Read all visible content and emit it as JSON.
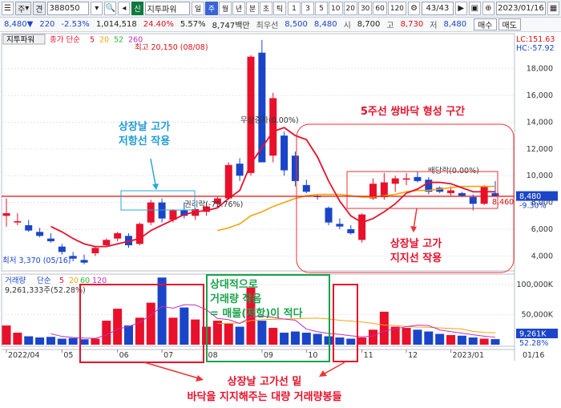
{
  "toolbar": {
    "market_selector": "주",
    "type_selector": "견",
    "code": "388050",
    "badge": "신",
    "name": "지투파워",
    "periods": [
      "일",
      "주",
      "월",
      "년",
      "분",
      "초",
      "틱"
    ],
    "selected_period": "주",
    "intervals": [
      "1",
      "3",
      "5",
      "10",
      "20",
      "30",
      "60",
      "120"
    ],
    "page_counter": "43",
    "page_total": "/43",
    "date": "2023/01/16"
  },
  "quote": {
    "price": "8,480▼",
    "change": "220",
    "change_pct": "-2.53%",
    "volume": "1,014,518",
    "turnover_pct": "24.40%",
    "vol_ratio": "5.57%",
    "trade_value": "8,747백만",
    "best_ask_label": "최우선",
    "best_ask": "8,500",
    "best_bid": "8,480",
    "open_label": "시",
    "open": "8,700",
    "high_label": "고",
    "high": "8,730",
    "low_label": "저",
    "low": "8,480",
    "sell_button": "매수",
    "buy_button": "매도"
  },
  "price_panel": {
    "legend_name": "지투파워",
    "legend_ma_label": "종가 단순",
    "ma_periods": [
      "5",
      "20",
      "52",
      "260"
    ],
    "ma_colors": [
      "#e8102b",
      "#f2a40d",
      "#2dbb2d",
      "#c02dc0"
    ],
    "lc": "LC:151.63",
    "hc": "HC:-57.92",
    "y_ticks": [
      "18,000",
      "16,000",
      "14,000",
      "12,000",
      "10,000",
      "8,000",
      "6,000",
      "4,000"
    ],
    "current_price": "8,480",
    "current_pct": "-9.30%",
    "ref_price": "8,460",
    "high_note": "최고 20,150 (08/08)",
    "low_note": "최저 3,370 (05/16)",
    "event_bonus": "무상증자(0.00%)",
    "event_lock": "권리락(-79.76%)",
    "event_dividend": "배당락(0.00%)"
  },
  "volume_panel": {
    "legend_name": "거래량",
    "legend_ma_label": "단순",
    "ma_periods": [
      "5",
      "20",
      "60",
      "120"
    ],
    "ma_colors": [
      "#e8102b",
      "#f2a40d",
      "#2dbb2d",
      "#c02dc0"
    ],
    "value": "9,261,333주(52.28%)",
    "y_ticks": [
      "100,000K",
      "50,000K"
    ],
    "current_value": "9,261K",
    "current_pct": "52.28%"
  },
  "x_axis": {
    "labels": [
      "2022/04",
      "05",
      "06",
      "07",
      "08",
      "09",
      "10",
      "11",
      "12",
      "2023/01"
    ],
    "right_label": "01/16"
  },
  "annotations": {
    "top_resistance": [
      "상장날 고가",
      "저항선 작용"
    ],
    "double_bottom": "5주선 쌍바닥 형성 구간",
    "support": [
      "상장날 고가",
      "지지선 작용"
    ],
    "volume_note": [
      "상대적으로",
      "거래량 작음",
      "= 매물(저항)이 적다"
    ],
    "bottom_note": [
      "상장날 고가선 밑",
      "바닥을 지지해주는 대량 거래량봉들"
    ]
  },
  "chart_data": {
    "type": "candlestick",
    "x": [
      "2022/04",
      "05",
      "06",
      "07",
      "08",
      "09",
      "10",
      "11",
      "12",
      "2023/01"
    ],
    "ylim": [
      3000,
      20500
    ],
    "candles": [
      {
        "o": 7000,
        "h": 8300,
        "l": 6200,
        "c": 7200
      },
      {
        "o": 6500,
        "h": 7200,
        "l": 6300,
        "c": 6600
      },
      {
        "o": 6300,
        "h": 6700,
        "l": 5800,
        "c": 5900
      },
      {
        "o": 5800,
        "h": 6100,
        "l": 5400,
        "c": 5500
      },
      {
        "o": 5300,
        "h": 5700,
        "l": 5000,
        "c": 5100
      },
      {
        "o": 4700,
        "h": 4900,
        "l": 4100,
        "c": 4300
      },
      {
        "o": 4000,
        "h": 4300,
        "l": 3600,
        "c": 3800
      },
      {
        "o": 3700,
        "h": 4100,
        "l": 3370,
        "c": 3500
      },
      {
        "o": 4200,
        "h": 4700,
        "l": 4000,
        "c": 4600
      },
      {
        "o": 4800,
        "h": 5300,
        "l": 4700,
        "c": 5200
      },
      {
        "o": 5300,
        "h": 5800,
        "l": 5100,
        "c": 5700
      },
      {
        "o": 5500,
        "h": 5700,
        "l": 4600,
        "c": 4800
      },
      {
        "o": 4900,
        "h": 6500,
        "l": 4800,
        "c": 6400
      },
      {
        "o": 6500,
        "h": 8200,
        "l": 6300,
        "c": 8000
      },
      {
        "o": 8000,
        "h": 8300,
        "l": 6500,
        "c": 6800
      },
      {
        "o": 6700,
        "h": 7500,
        "l": 6500,
        "c": 7400
      },
      {
        "o": 7400,
        "h": 8000,
        "l": 6800,
        "c": 7000
      },
      {
        "o": 7000,
        "h": 7600,
        "l": 6700,
        "c": 7500
      },
      {
        "o": 7300,
        "h": 8000,
        "l": 7000,
        "c": 7700
      },
      {
        "o": 7900,
        "h": 8400,
        "l": 7600,
        "c": 8300
      },
      {
        "o": 8300,
        "h": 11000,
        "l": 8200,
        "c": 10800
      },
      {
        "o": 10900,
        "h": 11300,
        "l": 9600,
        "c": 10000
      },
      {
        "o": 10200,
        "h": 19000,
        "l": 10000,
        "c": 18900
      },
      {
        "o": 19200,
        "h": 20150,
        "l": 15000,
        "c": 11000
      },
      {
        "o": 11500,
        "h": 16200,
        "l": 11000,
        "c": 15800
      },
      {
        "o": 13000,
        "h": 13300,
        "l": 10000,
        "c": 10400
      },
      {
        "o": 11500,
        "h": 11800,
        "l": 9200,
        "c": 9600
      },
      {
        "o": 9300,
        "h": 9700,
        "l": 8700,
        "c": 8800
      },
      {
        "o": 8500,
        "h": 8600,
        "l": 8200,
        "c": 8400
      },
      {
        "o": 7600,
        "h": 7700,
        "l": 6300,
        "c": 6500
      },
      {
        "o": 6400,
        "h": 6800,
        "l": 6000,
        "c": 6200
      },
      {
        "o": 6000,
        "h": 6300,
        "l": 5600,
        "c": 5700
      },
      {
        "o": 5200,
        "h": 7200,
        "l": 5000,
        "c": 7100
      },
      {
        "o": 8300,
        "h": 9800,
        "l": 8200,
        "c": 9400
      },
      {
        "o": 8400,
        "h": 10200,
        "l": 8200,
        "c": 9500
      },
      {
        "o": 9400,
        "h": 10000,
        "l": 8800,
        "c": 9800
      },
      {
        "o": 9700,
        "h": 10200,
        "l": 9300,
        "c": 9800
      },
      {
        "o": 9900,
        "h": 10300,
        "l": 9500,
        "c": 9600
      },
      {
        "o": 9700,
        "h": 9900,
        "l": 8600,
        "c": 8800
      },
      {
        "o": 9100,
        "h": 9200,
        "l": 8700,
        "c": 8800
      },
      {
        "o": 8700,
        "h": 9200,
        "l": 8500,
        "c": 8900
      },
      {
        "o": 8700,
        "h": 8800,
        "l": 8400,
        "c": 8500
      },
      {
        "o": 8400,
        "h": 8600,
        "l": 7400,
        "c": 7900
      },
      {
        "o": 7900,
        "h": 9300,
        "l": 7800,
        "c": 9200
      },
      {
        "o": 8700,
        "h": 9600,
        "l": 8480,
        "c": 8480
      }
    ],
    "ma5": [
      null,
      null,
      null,
      null,
      6200,
      5800,
      5300,
      4900,
      4700,
      4700,
      4900,
      5100,
      5300,
      5900,
      6300,
      6700,
      7100,
      7300,
      7400,
      7600,
      8300,
      8900,
      10900,
      12100,
      13300,
      13600,
      13000,
      12700,
      11400,
      9600,
      8100,
      7000,
      6500,
      6800,
      7300,
      7900,
      8700,
      9000,
      9500,
      9500,
      9400,
      9100,
      8800,
      8800,
      8800
    ],
    "ma20": [
      null,
      null,
      null,
      null,
      null,
      null,
      null,
      null,
      null,
      null,
      null,
      null,
      null,
      null,
      null,
      null,
      null,
      null,
      null,
      5900,
      6100,
      6400,
      7000,
      7300,
      7700,
      8000,
      8300,
      8500,
      8600,
      8600,
      8600,
      8500,
      8400,
      8400,
      8500,
      8600,
      8800,
      8900,
      8900,
      9000,
      9100,
      9200,
      9200,
      9200,
      9200
    ],
    "volume_unit": "K shares",
    "volume_ylim": [
      0,
      115000
    ],
    "volume": [
      32000,
      20000,
      14000,
      12000,
      13000,
      10000,
      11000,
      9000,
      10000,
      40000,
      60000,
      32000,
      45000,
      70000,
      112000,
      45000,
      62000,
      42000,
      30000,
      40000,
      35000,
      30000,
      95000,
      40000,
      28000,
      20000,
      22000,
      20000,
      18000,
      14000,
      12000,
      10000,
      12000,
      25000,
      55000,
      30000,
      28000,
      25000,
      22000,
      18000,
      16000,
      15000,
      12000,
      10000,
      9261
    ]
  }
}
